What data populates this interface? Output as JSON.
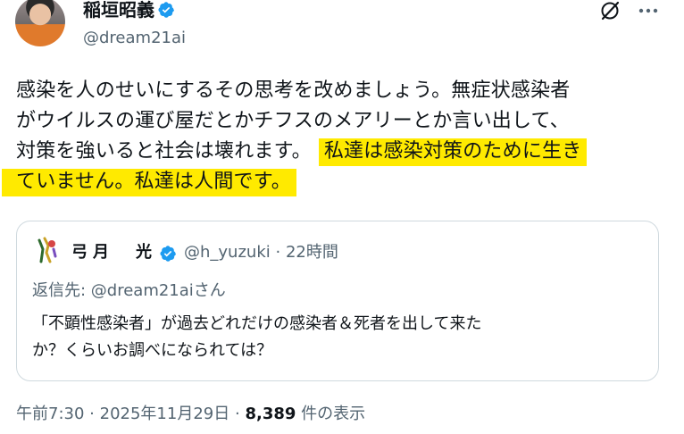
{
  "author": {
    "name": "稲垣昭義",
    "handle": "@dream21ai",
    "verified": true
  },
  "tweet": {
    "line1": "感染を人のせいにするその思考を改めましょう。無症状感染者",
    "line2": "がウイルスの運び屋だとかチフスのメアリーとか言い出して、",
    "line3_plain": "対策を強いると社会は壊れます。",
    "line3_highlight": "私達は感染対策のために生き",
    "line4_highlight": "ていません。私達は人間です。",
    "highlight_color": "#ffea00"
  },
  "quote": {
    "name": "弓月　光",
    "handle": "@h_yuzuki",
    "separator": "·",
    "time": "22時間",
    "reply_to": "返信先: @dream21aiさん",
    "line1": "「不顕性感染者」が過去どれだけの感染者＆死者を出して来た",
    "line2": "か？くらいお調べになられては？"
  },
  "footer": {
    "time": "午前7:30",
    "date": "2025年11月29日",
    "separator": "·",
    "views": "8,389",
    "views_label": "件の表示"
  },
  "colors": {
    "verified_blue": "#1d9bf0",
    "secondary_text": "#536471",
    "border": "#cfd9de"
  },
  "icons": [
    "verified-badge-icon",
    "grok-icon",
    "more-icon",
    "avatar"
  ]
}
